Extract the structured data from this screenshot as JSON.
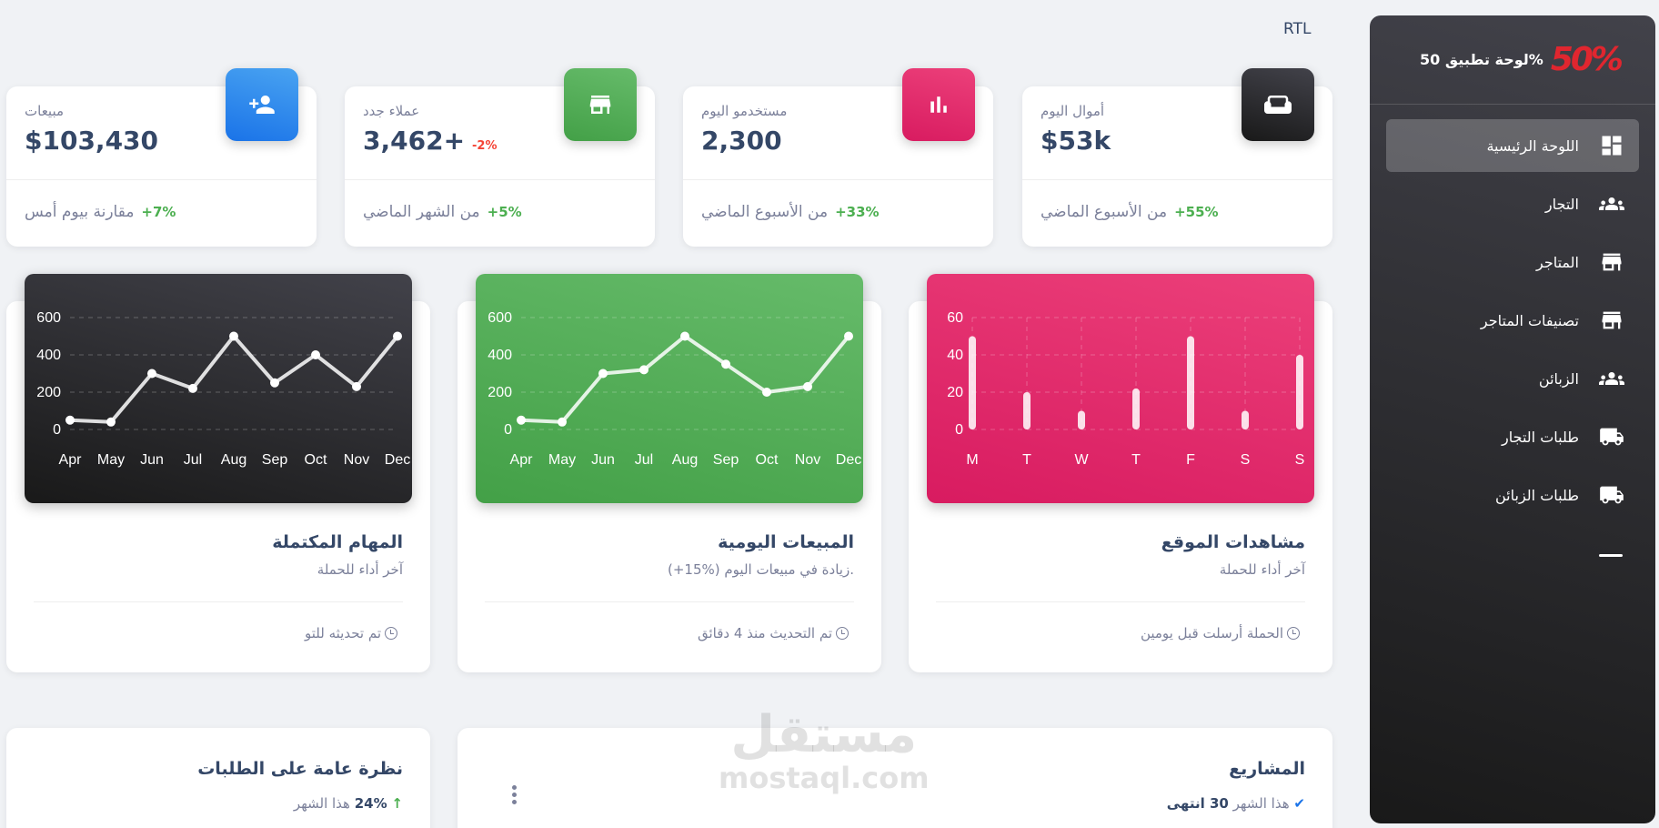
{
  "header": {
    "direction_label": "RTL"
  },
  "sidebar": {
    "brand_logo": "50%",
    "brand_name": "لوحة تطبيق 50%",
    "items": [
      {
        "label": "اللوحة الرئيسية",
        "icon": "dashboard-icon",
        "active": true
      },
      {
        "label": "التجار",
        "icon": "users-icon"
      },
      {
        "label": "المتاجر",
        "icon": "store-icon"
      },
      {
        "label": "تصنيفات المتاجر",
        "icon": "store-icon"
      },
      {
        "label": "الزبائن",
        "icon": "users-icon"
      },
      {
        "label": "طلبات التجار",
        "icon": "truck-icon"
      },
      {
        "label": "طلبات الزبائن",
        "icon": "truck-icon"
      }
    ]
  },
  "stats": [
    {
      "label": "أموال اليوم",
      "value": "$53k",
      "delta": "",
      "foot_pct": "+55%",
      "foot_text": "من الأسبوع الماضي",
      "icon": "sofa-icon",
      "color": "#191919"
    },
    {
      "label": "مستخدمو اليوم",
      "value": "2,300",
      "delta": "",
      "foot_pct": "+33%",
      "foot_text": "من الأسبوع الماضي",
      "icon": "chart-icon",
      "color": "#e91e63"
    },
    {
      "label": "عملاء جدد",
      "value": "3,462+",
      "delta": "-2%",
      "foot_pct": "+5%",
      "foot_text": "من الشهر الماضي",
      "icon": "store-icon",
      "color": "#4caf50"
    },
    {
      "label": "مبيعات",
      "value": "$103,430",
      "delta": "",
      "foot_pct": "+7%",
      "foot_text": "مقارنة بيوم أمس",
      "icon": "person-add-icon",
      "color": "#1a73e8"
    }
  ],
  "charts": [
    {
      "title": "مشاهدات الموقع",
      "sub": "آخر أداء للحملة",
      "foot": "الحملة أرسلت قبل يومين"
    },
    {
      "title": "المبيعات اليومية",
      "sub": "(+15%) زيادة في مبيعات اليوم.",
      "foot": "تم التحديث منذ 4 دقائق"
    },
    {
      "title": "المهام المكتملة",
      "sub": "آخر أداء للحملة",
      "foot": "تم تحديثه للتو"
    }
  ],
  "chart_data": [
    {
      "type": "bar",
      "categories": [
        "M",
        "T",
        "W",
        "T",
        "F",
        "S",
        "S"
      ],
      "values": [
        50,
        20,
        10,
        22,
        50,
        10,
        40
      ],
      "ylim": [
        0,
        60
      ],
      "yticks": [
        0,
        20,
        40,
        60
      ],
      "grid": true
    },
    {
      "type": "line",
      "categories": [
        "Apr",
        "May",
        "Jun",
        "Jul",
        "Aug",
        "Sep",
        "Oct",
        "Nov",
        "Dec"
      ],
      "values": [
        50,
        40,
        300,
        320,
        500,
        350,
        200,
        230,
        500
      ],
      "ylim": [
        0,
        600
      ],
      "yticks": [
        0,
        200,
        400,
        600
      ],
      "grid": true
    },
    {
      "type": "line",
      "categories": [
        "Apr",
        "May",
        "Jun",
        "Jul",
        "Aug",
        "Sep",
        "Oct",
        "Nov",
        "Dec"
      ],
      "values": [
        50,
        40,
        300,
        220,
        500,
        250,
        400,
        230,
        500
      ],
      "ylim": [
        0,
        600
      ],
      "yticks": [
        0,
        200,
        400,
        600
      ],
      "grid": true
    }
  ],
  "projects": {
    "title": "المشاريع",
    "done": "30 انتهى",
    "period": "هذا الشهر"
  },
  "orders": {
    "title": "نظرة عامة على الطلبات",
    "pct": "24%",
    "period": "هذا الشهر"
  },
  "watermark": {
    "ar": "مستقل",
    "en": "mostaql.com"
  }
}
